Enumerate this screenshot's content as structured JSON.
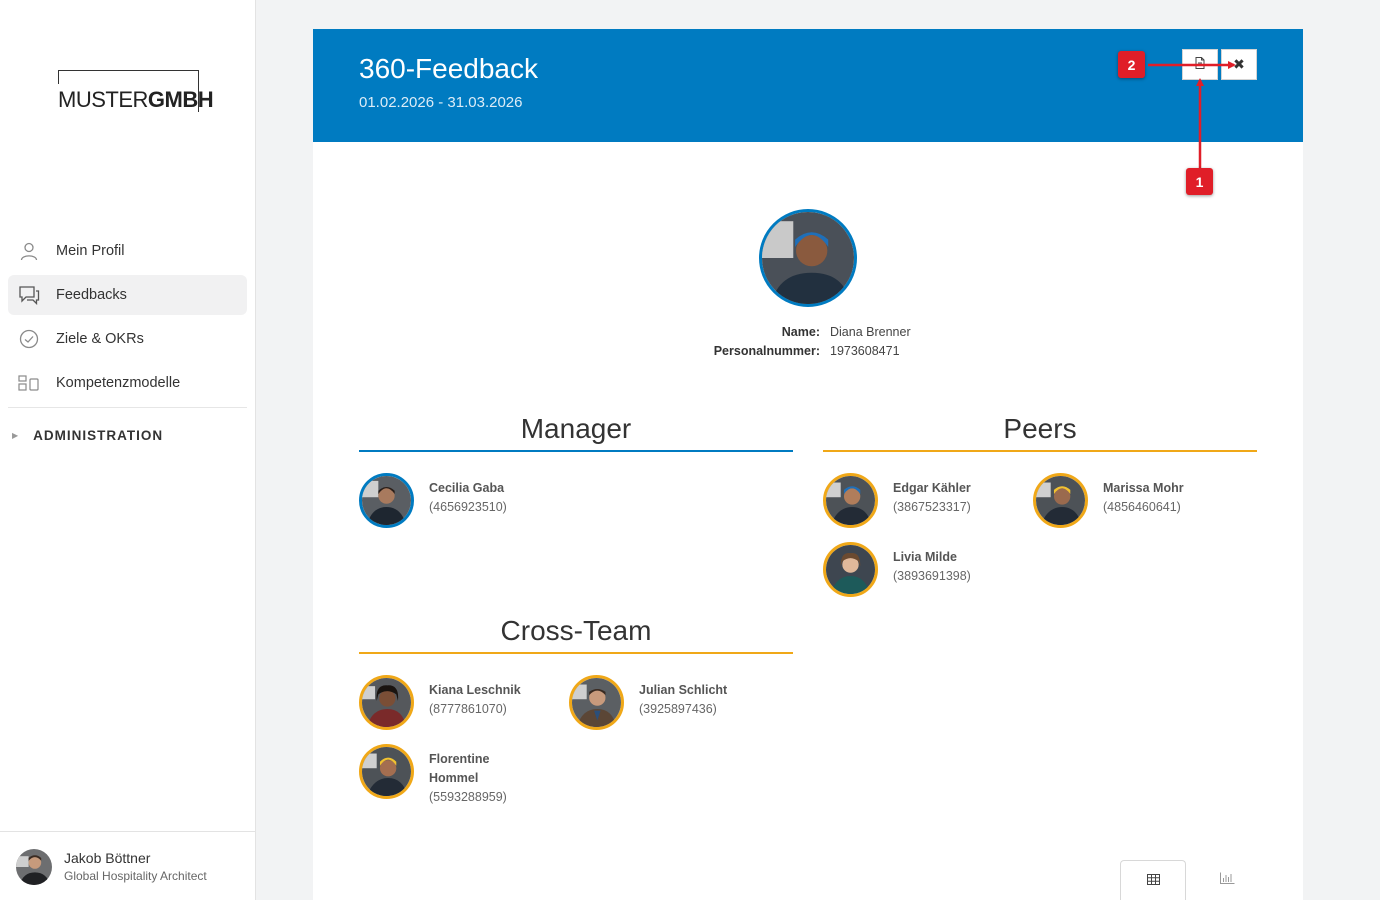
{
  "brand": {
    "logo_light": "MUSTER",
    "logo_bold": "GMBH"
  },
  "sidebar": {
    "items": [
      {
        "label": "Mein Profil",
        "icon": "user-icon"
      },
      {
        "label": "Feedbacks",
        "icon": "chat-icon",
        "active": true
      },
      {
        "label": "Ziele & OKRs",
        "icon": "check-circle-icon"
      },
      {
        "label": "Kompetenzmodelle",
        "icon": "model-icon"
      }
    ],
    "admin_label": "ADMINISTRATION"
  },
  "current_user": {
    "name": "Jakob Böttner",
    "role": "Global Hospitality Architect"
  },
  "feedback": {
    "title": "360-Feedback",
    "period": "01.02.2026 - 31.03.2026",
    "close_symbol": "✖",
    "employee": {
      "name_label": "Name:",
      "name": "Diana Brenner",
      "number_label": "Personalnummer:",
      "number": "1973608471"
    },
    "sections": {
      "manager": {
        "title": "Manager",
        "people": [
          {
            "name": "Cecilia Gaba",
            "id": "(4656923510)"
          }
        ]
      },
      "peers": {
        "title": "Peers",
        "people": [
          {
            "name": "Edgar Kähler",
            "id": "(3867523317)"
          },
          {
            "name": "Marissa Mohr",
            "id": "(4856460641)"
          },
          {
            "name": "Livia Milde",
            "id": "(3893691398)"
          }
        ]
      },
      "cross_team": {
        "title": "Cross-Team",
        "people": [
          {
            "name": "Kiana Leschnik",
            "id": "(8777861070)"
          },
          {
            "name": "Julian Schlicht",
            "id": "(3925897436)"
          },
          {
            "name": "Florentine Hommel",
            "id": "(5593288959)"
          }
        ]
      }
    }
  },
  "annotations": {
    "badge_1": "1",
    "badge_2": "2"
  },
  "colors": {
    "primary": "#007bc1",
    "accent": "#f0a818",
    "annotation": "#e01e28"
  }
}
